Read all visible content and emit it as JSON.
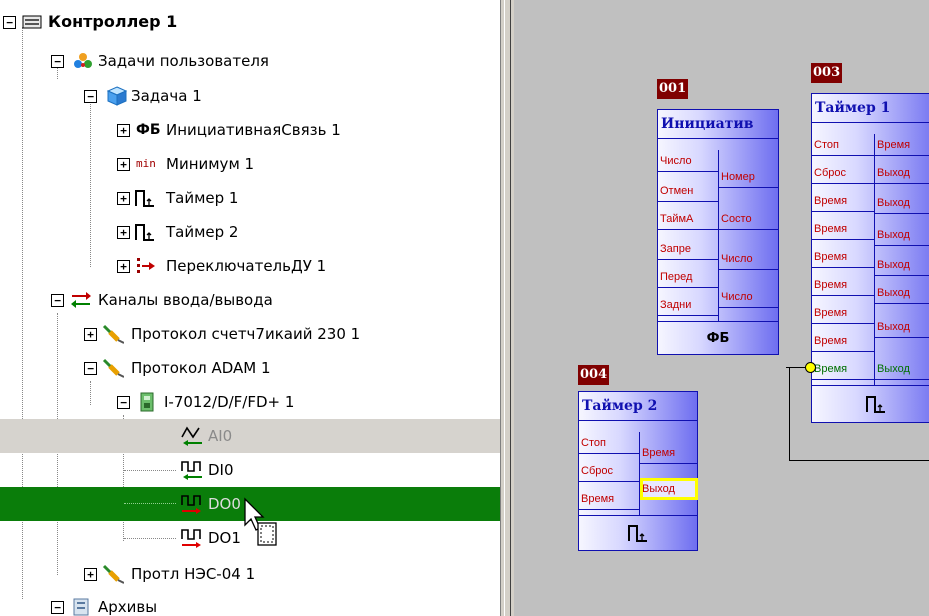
{
  "tree": {
    "controller": {
      "label": "Контроллер 1",
      "icon": "controller-icon"
    },
    "user_tasks": {
      "label": "Задачи пользователя",
      "icon": "user-tasks-icon"
    },
    "task1": {
      "label": "Задача 1",
      "icon": "cube-icon"
    },
    "fb_item": {
      "label": "ИнициативнаяСвязь 1",
      "icon_text": "ФБ"
    },
    "min_item": {
      "label": "Минимум 1",
      "icon_text": "min"
    },
    "timer1": {
      "label": "Таймер 1",
      "icon": "timer-icon"
    },
    "timer2": {
      "label": "Таймер 2",
      "icon": "timer-icon"
    },
    "switch_du": {
      "label": "ПереключательДУ 1",
      "icon": "switch-icon"
    },
    "io_channels": {
      "label": "Каналы ввода/вывода",
      "icon": "io-arrows-icon"
    },
    "proto_counter": {
      "label": "Протокол счетч7икаий 230 1",
      "icon": "plug-icon"
    },
    "proto_adam": {
      "label": "Протокол ADAM 1",
      "icon": "plug-icon"
    },
    "module": {
      "label": "I-7012/D/F/FD+ 1",
      "icon": "module-icon"
    },
    "ai0": {
      "label": "AI0",
      "icon": "analog-input-icon"
    },
    "di0": {
      "label": "DI0",
      "icon": "digital-input-icon"
    },
    "do0": {
      "label": "DO0",
      "icon": "digital-output-icon"
    },
    "do1": {
      "label": "DO1",
      "icon": "digital-output-icon"
    },
    "proto_nes": {
      "label": "Протл НЭС-04 1",
      "icon": "plug-icon"
    },
    "archives": {
      "label": "Архивы",
      "icon": "archive-icon"
    }
  },
  "canvas": {
    "block_fb": {
      "tag": "001",
      "title": "Инициатив",
      "inputs": [
        "Число",
        "Отмен",
        "ТаймА",
        "Запре",
        "Перед",
        "Задни"
      ],
      "outputs": [
        "Номер",
        "Состо",
        "Число",
        "Число"
      ],
      "footer": "ФБ"
    },
    "block_timer1": {
      "tag": "003",
      "title": "Таймер 1",
      "inputs": [
        "Стоп",
        "Сброс",
        "Время",
        "Время",
        "Время",
        "Время",
        "Время",
        "Время",
        "Время"
      ],
      "outputs": [
        "Время",
        "Выход",
        "Выход",
        "Выход",
        "Выход",
        "Выход",
        "Выход",
        "Выход"
      ]
    },
    "block_timer2": {
      "tag": "004",
      "title": "Таймер 2",
      "inputs": [
        "Стоп",
        "Сброс",
        "Время"
      ],
      "outputs": [
        "Время",
        "Выход"
      ]
    }
  },
  "colors": {
    "selection": "#0a7d0a",
    "block_border": "#1010b0",
    "tag_bg": "#800000",
    "canvas_bg": "#c0c0c0"
  }
}
